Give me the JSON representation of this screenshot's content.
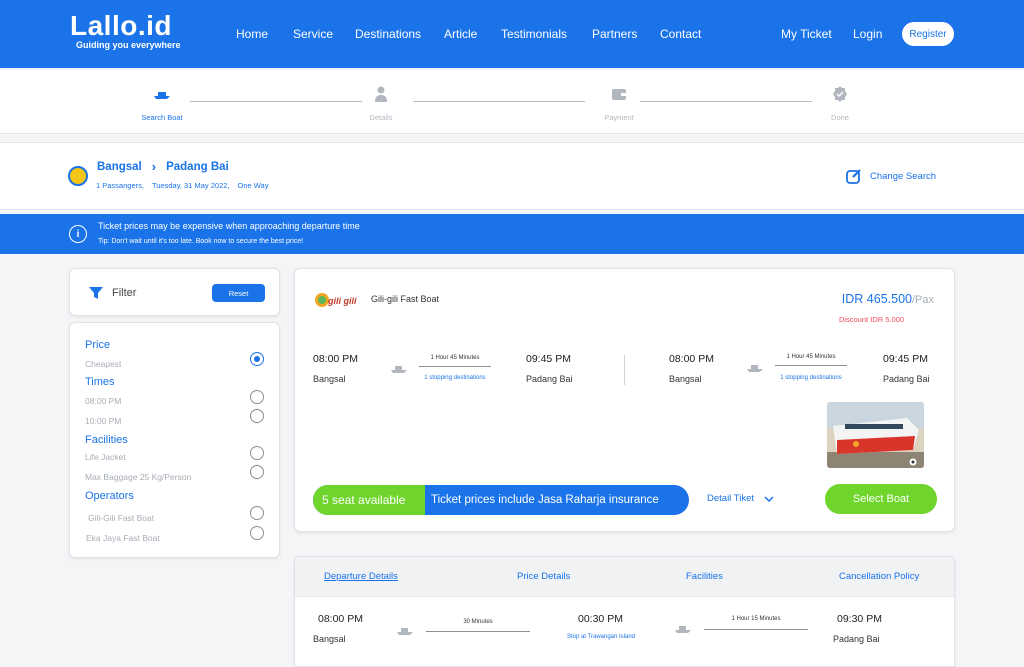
{
  "nav": {
    "logo": "Lallo.id",
    "tagline": "Guiding you everywhere",
    "links": [
      "Home",
      "Service",
      "Destinations",
      "Article",
      "Testimonials",
      "Partners",
      "Contact"
    ],
    "my_ticket": "My Ticket",
    "login": "Login",
    "register": "Register"
  },
  "stepper": {
    "steps": [
      "Search  Boat",
      "Details",
      "Payment",
      "Done"
    ]
  },
  "route": {
    "from": "Bangsal",
    "to": "Padang Bai",
    "passengers": "1 Passangers,",
    "date": "Tuesday, 31 May 2022,",
    "trip": "One Way",
    "change_search": "Change Search"
  },
  "banner": {
    "title": "Ticket prices may be expensive when approaching departure time",
    "tip": "Tip:  Don't wait until it's too late. Book now to secure the best price!"
  },
  "filter": {
    "title": "Filter",
    "reset": "Reset",
    "price_title": "Price",
    "price_options": [
      "Cheapest"
    ],
    "times_title": "Times",
    "times_options": [
      "08:00 PM",
      "10:00 PM"
    ],
    "facilities_title": "Facilities",
    "facilities_options": [
      "Life Jacket",
      "Max Baggage 25 Kg/Person"
    ],
    "operators_title": "Operators",
    "operators_options": [
      "Gili-Gili Fast Boat",
      "Eka Jaya Fast Boat"
    ]
  },
  "result": {
    "operator_logo_text": "gili gili",
    "operator": "Gili-gili Fast Boat",
    "price": "IDR 465.500",
    "price_unit": "/Pax",
    "discount": "Discount IDR 5.000",
    "legs": [
      {
        "depart_time": "08:00 PM",
        "depart_place": "Bangsal",
        "duration": "1 Hour 45 Minutes",
        "stops": "1 stopping destinations",
        "arrive_time": "09:45 PM",
        "arrive_place": "Padang Bai"
      },
      {
        "depart_time": "08:00 PM",
        "depart_place": "Bangsal",
        "duration": "1 Hour 45 Minutes",
        "stops": "1 stopping destinations",
        "arrive_time": "09:45 PM",
        "arrive_place": "Padang Bai"
      }
    ],
    "seats": "5 seat available",
    "seat_info": "Ticket prices include Jasa Raharja insurance",
    "detail_tiket": "Detail Tiket",
    "select": "Select Boat"
  },
  "details": {
    "tabs": [
      "Departure Details",
      "Price Details",
      "Facilities",
      "Cancellation Policy"
    ],
    "row": {
      "t1": "08:00 PM",
      "p1": "Bangsal",
      "d1": "30 Minutes",
      "t2": "00:30 PM",
      "stop": "Stop at Trawangan Island",
      "d2": "1 Hour 15 Minutes",
      "t3": "09:30 PM",
      "p3": "Padang Bai"
    }
  },
  "colors": {
    "primary": "#1a73e8",
    "green": "#6fd42c",
    "danger": "#ef4a5b"
  }
}
